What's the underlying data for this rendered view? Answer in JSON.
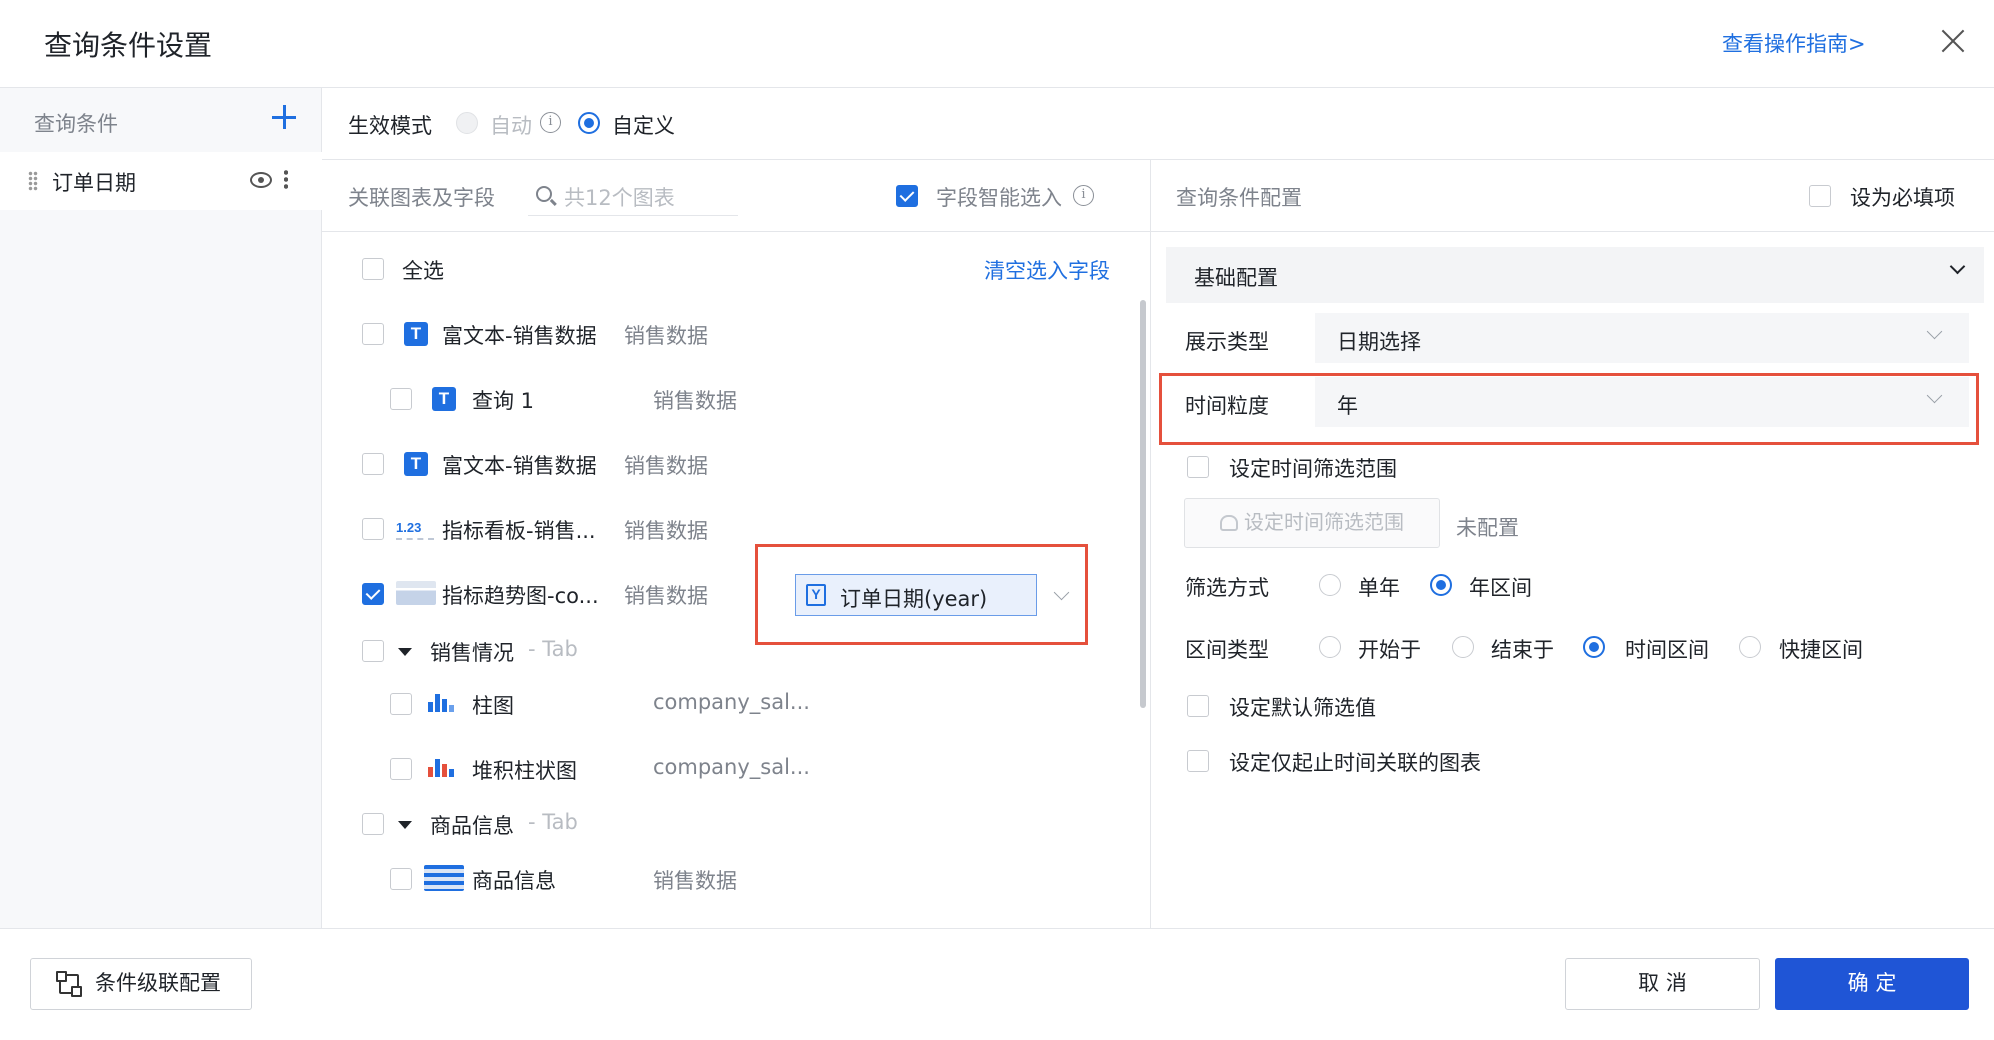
{
  "dialog": {
    "title": "查询条件设置",
    "guide_link": "查看操作指南>"
  },
  "left": {
    "title": "查询条件",
    "items": [
      {
        "label": "订单日期"
      }
    ]
  },
  "mode": {
    "label": "生效模式",
    "options": [
      "自动",
      "自定义"
    ],
    "selected": "自定义"
  },
  "charts": {
    "header": "关联图表及字段",
    "search_placeholder": "共12个图表",
    "smart_select_label": "字段智能选入",
    "select_all": "全选",
    "clear_link": "清空选入字段",
    "rows": [
      {
        "name": "富文本-销售数据",
        "source": "销售数据",
        "checked": false
      },
      {
        "name": "查询 1",
        "source": "销售数据",
        "checked": false
      },
      {
        "name": "富文本-销售数据",
        "source": "销售数据",
        "checked": false
      },
      {
        "name": "指标看板-销售...",
        "source": "销售数据",
        "checked": false
      },
      {
        "name": "指标趋势图-co...",
        "source": "销售数据",
        "checked": true,
        "field": "订单日期(year)"
      },
      {
        "name": "销售情况",
        "tab": "- Tab"
      },
      {
        "name": "柱图",
        "source": "company_sal..."
      },
      {
        "name": "堆积柱状图",
        "source": "company_sal..."
      },
      {
        "name": "商品信息",
        "tab": "- Tab"
      },
      {
        "name": "商品信息",
        "source": "销售数据"
      }
    ],
    "kpi_icon_text": "1.23",
    "y_icon_text": "Y",
    "t_icon_text": "T"
  },
  "config": {
    "header": "查询条件配置",
    "required_label": "设为必填项",
    "section": "基础配置",
    "display_type_label": "展示类型",
    "display_type_value": "日期选择",
    "granularity_label": "时间粒度",
    "granularity_value": "年",
    "time_range_cb": "设定时间筛选范围",
    "time_range_btn": "设定时间筛选范围",
    "time_range_status": "未配置",
    "filter_mode_label": "筛选方式",
    "filter_modes": [
      "单年",
      "年区间"
    ],
    "filter_mode_selected": "年区间",
    "range_type_label": "区间类型",
    "range_types": [
      "开始于",
      "结束于",
      "时间区间",
      "快捷区间"
    ],
    "range_type_selected": "时间区间",
    "default_value_cb": "设定默认筛选值",
    "linked_only_cb": "设定仅起止时间关联的图表"
  },
  "footer": {
    "cascade_btn": "条件级联配置",
    "cancel_btn": "取 消",
    "ok_btn": "确 定"
  },
  "colors": {
    "accent": "#1f6fe0",
    "primary_btn": "#1f55d6",
    "highlight": "#e5503c"
  }
}
